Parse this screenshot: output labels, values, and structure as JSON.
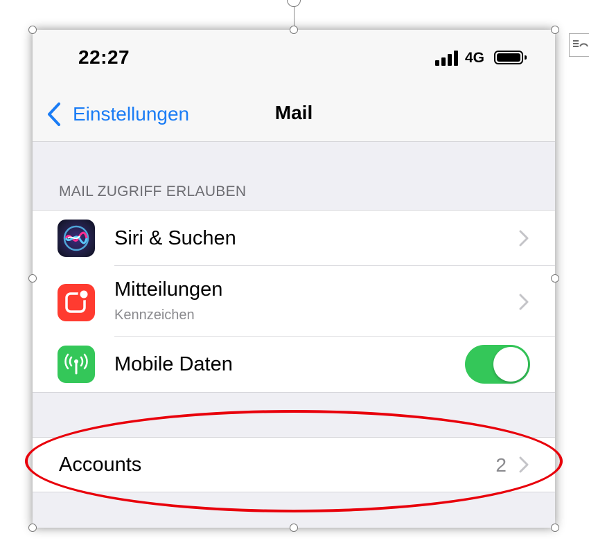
{
  "status_bar": {
    "time": "22:27",
    "network": "4G",
    "icons": [
      "signal-icon",
      "battery-icon"
    ]
  },
  "navbar": {
    "back_label": "Einstellungen",
    "title": "Mail"
  },
  "section": {
    "header": "MAIL ZUGRIFF ERLAUBEN",
    "rows": [
      {
        "label": "Siri & Suchen",
        "icon": "siri-icon",
        "icon_bg": "#1c1c3a",
        "accessory": "chevron"
      },
      {
        "label": "Mitteilungen",
        "sublabel": "Kennzeichen",
        "icon": "notifications-icon",
        "icon_bg": "#ff3b30",
        "accessory": "chevron"
      },
      {
        "label": "Mobile Daten",
        "icon": "cellular-antenna-icon",
        "icon_bg": "#34c759",
        "accessory": "toggle",
        "toggle_on": true
      }
    ]
  },
  "accounts": {
    "label": "Accounts",
    "value": "2"
  },
  "colors": {
    "accent": "#1a7cf5",
    "toggle_on": "#34c759",
    "annotation": "#e8000b",
    "background": "#efeff4"
  }
}
